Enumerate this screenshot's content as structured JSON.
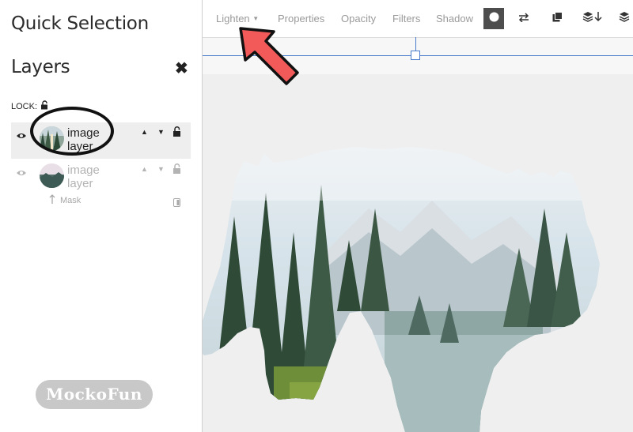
{
  "app": {
    "brand": "MockoFun"
  },
  "sidebar": {
    "quick_selection_title": "Quick Selection",
    "layers_title": "Layers",
    "close_label": "✖",
    "lock_label": "LOCK:",
    "layers": [
      {
        "name": "image layer",
        "name_line1": "image",
        "name_line2": "layer",
        "active": true
      },
      {
        "name": "image layer",
        "name_line1": "image",
        "name_line2": "layer",
        "active": false
      }
    ],
    "mask_label": "Mask"
  },
  "toolbar": {
    "blend_mode": "Lighten",
    "properties_label": "Properties",
    "opacity_label": "Opacity",
    "filters_label": "Filters",
    "shadow_label": "Shadow"
  },
  "icons": {
    "eye": "eye-icon",
    "lock": "lock-open-icon",
    "arrow_up": "caret-up-icon",
    "arrow_down": "caret-down-icon",
    "mask": "mask-toggle-icon",
    "circle": "circle-shape-icon",
    "swap": "swap-arrows-icon",
    "duplicate": "duplicate-icon",
    "layers_down": "layers-down-icon",
    "layers": "layers-icon"
  },
  "colors": {
    "annotation_arrow": "#f25a5a",
    "guide_line": "#4a7ccc",
    "active_layer_bg": "#eeeeee"
  }
}
